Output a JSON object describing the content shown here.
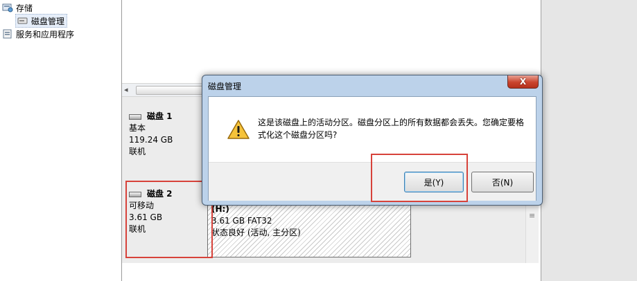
{
  "sidebar": {
    "storage": "存储",
    "disk_management": "磁盘管理",
    "services": "服务和应用程序"
  },
  "disks": [
    {
      "name": "磁盘 1",
      "type": "基本",
      "size": "119.24 GB",
      "status": "联机"
    },
    {
      "name": "磁盘 2",
      "type": "可移动",
      "size": "3.61 GB",
      "status": "联机"
    }
  ],
  "partition": {
    "label": "(H:)",
    "size_fs": "3.61 GB FAT32",
    "status": "状态良好 (活动, 主分区)"
  },
  "dialog": {
    "title": "磁盘管理",
    "close": "X",
    "message": "这是该磁盘上的活动分区。磁盘分区上的所有数据都会丢失。您确定要格式化这个磁盘分区吗?",
    "yes_label": "是(Y)",
    "no_label": "否(N)"
  },
  "colors": {
    "highlight": "#d7423a",
    "dialog_frame": "#bcd2ea",
    "close_button": "#c9442e"
  },
  "icons": [
    "storage-icon",
    "disk-management-icon",
    "services-icon",
    "disk-icon",
    "warning-icon"
  ]
}
